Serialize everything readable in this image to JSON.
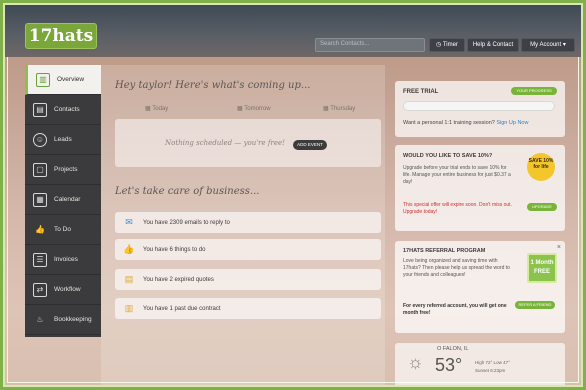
{
  "header": {
    "logo": "17hats",
    "search_placeholder": "Search Contacts...",
    "timer": "Timer",
    "help": "Help & Contact",
    "account": "My Account"
  },
  "sidebar": {
    "items": [
      {
        "label": "Overview",
        "icon": "chart-icon"
      },
      {
        "label": "Contacts",
        "icon": "contacts-icon"
      },
      {
        "label": "Leads",
        "icon": "user-icon"
      },
      {
        "label": "Projects",
        "icon": "project-icon"
      },
      {
        "label": "Calendar",
        "icon": "calendar-icon"
      },
      {
        "label": "To Do",
        "icon": "thumb-icon"
      },
      {
        "label": "Invoices",
        "icon": "invoice-icon"
      },
      {
        "label": "Workflow",
        "icon": "workflow-icon"
      },
      {
        "label": "Bookkeeping",
        "icon": "piggy-icon"
      }
    ]
  },
  "main": {
    "greeting": "Hey taylor! Here's what's coming up...",
    "days": [
      "Today",
      "Tomorrow",
      "Thursday"
    ],
    "schedule_empty": "Nothing scheduled — you're free!",
    "add_event": "ADD EVENT",
    "business_title": "Let's take care of business...",
    "tasks": [
      {
        "text": "You have 2309 emails to reply to",
        "icon": "email-icon"
      },
      {
        "text": "You have 6 things to do",
        "icon": "thumb-icon"
      },
      {
        "text": "You have 2 expired quotes",
        "icon": "quote-icon"
      },
      {
        "text": "You have 1 past due contract",
        "icon": "contract-icon"
      }
    ]
  },
  "trial": {
    "title": "FREE TRIAL",
    "button": "YOUR PROGRESS",
    "text": "Want a personal 1:1 training session?",
    "link": "Sign Up Now"
  },
  "save": {
    "title": "WOULD YOU LIKE TO SAVE 10%?",
    "text": "Upgrade before your trial ends to save 10% for life. Manage your entire business for just $0.37 a day!",
    "warning": "This special offer will expire soon. Don't miss out. Upgrade today!",
    "badge": "SAVE 10% for life",
    "button": "UPGRADE"
  },
  "referral": {
    "title": "17HATS REFERRAL PROGRAM",
    "text": "Love being organized and saving time with 17hats? Then please help us spread the word to your friends and colleagues!",
    "bold": "For every referred account, you will get one month free!",
    "button": "REFER A FRIEND",
    "gift": "1 Month FREE",
    "close": "×"
  },
  "weather": {
    "city": "O FALON, IL",
    "temp": "53°",
    "detail": "High 72° Low 47°",
    "sunset": "Sunset 6:23pm",
    "icon": "sun-icon"
  },
  "colors": {
    "accent": "#79b43a",
    "sidebar": "#3b3a3c",
    "warning": "#d0312d"
  }
}
